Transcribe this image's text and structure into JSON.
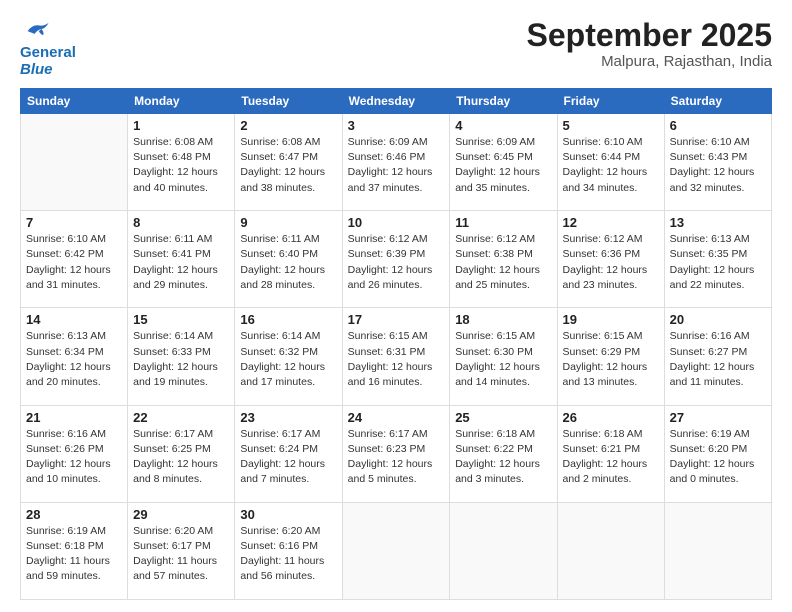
{
  "logo": {
    "line1": "General",
    "line2": "Blue"
  },
  "header": {
    "month": "September 2025",
    "location": "Malpura, Rajasthan, India"
  },
  "weekdays": [
    "Sunday",
    "Monday",
    "Tuesday",
    "Wednesday",
    "Thursday",
    "Friday",
    "Saturday"
  ],
  "weeks": [
    [
      {
        "day": "",
        "info": ""
      },
      {
        "day": "1",
        "info": "Sunrise: 6:08 AM\nSunset: 6:48 PM\nDaylight: 12 hours\nand 40 minutes."
      },
      {
        "day": "2",
        "info": "Sunrise: 6:08 AM\nSunset: 6:47 PM\nDaylight: 12 hours\nand 38 minutes."
      },
      {
        "day": "3",
        "info": "Sunrise: 6:09 AM\nSunset: 6:46 PM\nDaylight: 12 hours\nand 37 minutes."
      },
      {
        "day": "4",
        "info": "Sunrise: 6:09 AM\nSunset: 6:45 PM\nDaylight: 12 hours\nand 35 minutes."
      },
      {
        "day": "5",
        "info": "Sunrise: 6:10 AM\nSunset: 6:44 PM\nDaylight: 12 hours\nand 34 minutes."
      },
      {
        "day": "6",
        "info": "Sunrise: 6:10 AM\nSunset: 6:43 PM\nDaylight: 12 hours\nand 32 minutes."
      }
    ],
    [
      {
        "day": "7",
        "info": "Sunrise: 6:10 AM\nSunset: 6:42 PM\nDaylight: 12 hours\nand 31 minutes."
      },
      {
        "day": "8",
        "info": "Sunrise: 6:11 AM\nSunset: 6:41 PM\nDaylight: 12 hours\nand 29 minutes."
      },
      {
        "day": "9",
        "info": "Sunrise: 6:11 AM\nSunset: 6:40 PM\nDaylight: 12 hours\nand 28 minutes."
      },
      {
        "day": "10",
        "info": "Sunrise: 6:12 AM\nSunset: 6:39 PM\nDaylight: 12 hours\nand 26 minutes."
      },
      {
        "day": "11",
        "info": "Sunrise: 6:12 AM\nSunset: 6:38 PM\nDaylight: 12 hours\nand 25 minutes."
      },
      {
        "day": "12",
        "info": "Sunrise: 6:12 AM\nSunset: 6:36 PM\nDaylight: 12 hours\nand 23 minutes."
      },
      {
        "day": "13",
        "info": "Sunrise: 6:13 AM\nSunset: 6:35 PM\nDaylight: 12 hours\nand 22 minutes."
      }
    ],
    [
      {
        "day": "14",
        "info": "Sunrise: 6:13 AM\nSunset: 6:34 PM\nDaylight: 12 hours\nand 20 minutes."
      },
      {
        "day": "15",
        "info": "Sunrise: 6:14 AM\nSunset: 6:33 PM\nDaylight: 12 hours\nand 19 minutes."
      },
      {
        "day": "16",
        "info": "Sunrise: 6:14 AM\nSunset: 6:32 PM\nDaylight: 12 hours\nand 17 minutes."
      },
      {
        "day": "17",
        "info": "Sunrise: 6:15 AM\nSunset: 6:31 PM\nDaylight: 12 hours\nand 16 minutes."
      },
      {
        "day": "18",
        "info": "Sunrise: 6:15 AM\nSunset: 6:30 PM\nDaylight: 12 hours\nand 14 minutes."
      },
      {
        "day": "19",
        "info": "Sunrise: 6:15 AM\nSunset: 6:29 PM\nDaylight: 12 hours\nand 13 minutes."
      },
      {
        "day": "20",
        "info": "Sunrise: 6:16 AM\nSunset: 6:27 PM\nDaylight: 12 hours\nand 11 minutes."
      }
    ],
    [
      {
        "day": "21",
        "info": "Sunrise: 6:16 AM\nSunset: 6:26 PM\nDaylight: 12 hours\nand 10 minutes."
      },
      {
        "day": "22",
        "info": "Sunrise: 6:17 AM\nSunset: 6:25 PM\nDaylight: 12 hours\nand 8 minutes."
      },
      {
        "day": "23",
        "info": "Sunrise: 6:17 AM\nSunset: 6:24 PM\nDaylight: 12 hours\nand 7 minutes."
      },
      {
        "day": "24",
        "info": "Sunrise: 6:17 AM\nSunset: 6:23 PM\nDaylight: 12 hours\nand 5 minutes."
      },
      {
        "day": "25",
        "info": "Sunrise: 6:18 AM\nSunset: 6:22 PM\nDaylight: 12 hours\nand 3 minutes."
      },
      {
        "day": "26",
        "info": "Sunrise: 6:18 AM\nSunset: 6:21 PM\nDaylight: 12 hours\nand 2 minutes."
      },
      {
        "day": "27",
        "info": "Sunrise: 6:19 AM\nSunset: 6:20 PM\nDaylight: 12 hours\nand 0 minutes."
      }
    ],
    [
      {
        "day": "28",
        "info": "Sunrise: 6:19 AM\nSunset: 6:18 PM\nDaylight: 11 hours\nand 59 minutes."
      },
      {
        "day": "29",
        "info": "Sunrise: 6:20 AM\nSunset: 6:17 PM\nDaylight: 11 hours\nand 57 minutes."
      },
      {
        "day": "30",
        "info": "Sunrise: 6:20 AM\nSunset: 6:16 PM\nDaylight: 11 hours\nand 56 minutes."
      },
      {
        "day": "",
        "info": ""
      },
      {
        "day": "",
        "info": ""
      },
      {
        "day": "",
        "info": ""
      },
      {
        "day": "",
        "info": ""
      }
    ]
  ]
}
